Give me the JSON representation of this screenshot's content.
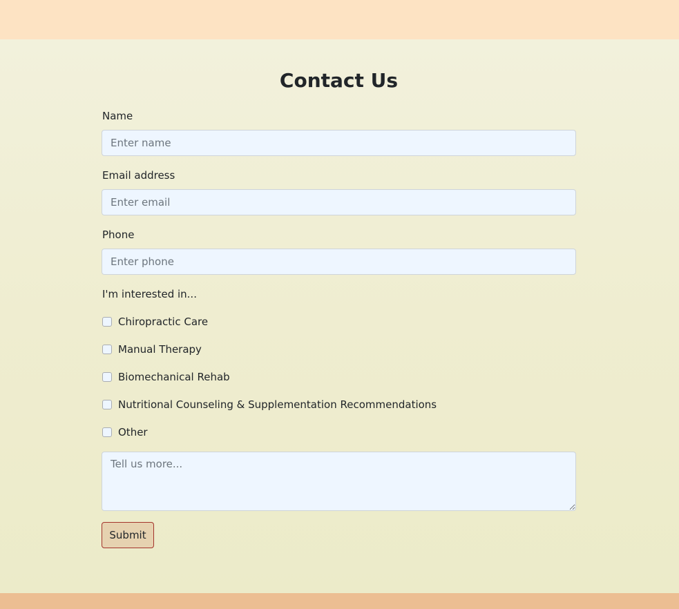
{
  "form": {
    "title": "Contact Us",
    "name_label": "Name",
    "name_placeholder": "Enter name",
    "email_label": "Email address",
    "email_placeholder": "Enter email",
    "phone_label": "Phone",
    "phone_placeholder": "Enter phone",
    "interests_label": "I'm interested in...",
    "interests": [
      {
        "label": "Chiropractic Care",
        "checked": false
      },
      {
        "label": "Manual Therapy",
        "checked": false
      },
      {
        "label": "Biomechanical Rehab",
        "checked": false
      },
      {
        "label": "Nutritional Counseling & Supplementation Recommendations",
        "checked": false
      },
      {
        "label": "Other",
        "checked": false
      }
    ],
    "message_placeholder": "Tell us more...",
    "submit_label": "Submit"
  },
  "colors": {
    "header_band": "#fde3c3",
    "page_background": "#efedd0",
    "footer_band": "#ecbe92",
    "input_background": "#eef6ff",
    "submit_background": "#e6d2b0",
    "submit_border": "#a3332b"
  }
}
